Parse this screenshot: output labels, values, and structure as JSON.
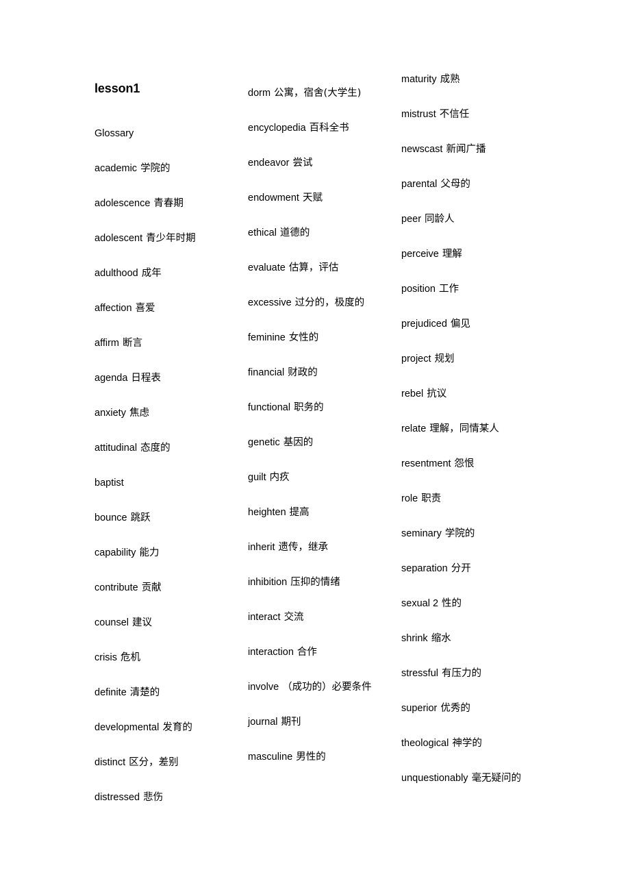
{
  "document": {
    "title": "lesson1",
    "columns": [
      {
        "id": "column-1",
        "entries": [
          {
            "term": "Glossary",
            "gloss": ""
          },
          {
            "term": "academic",
            "gloss": "学院的"
          },
          {
            "term": "adolescence",
            "gloss": "青春期"
          },
          {
            "term": "adolescent",
            "gloss": "青少年时期"
          },
          {
            "term": "adulthood",
            "gloss": "成年"
          },
          {
            "term": "affection",
            "gloss": "喜爱"
          },
          {
            "term": "affirm",
            "gloss": "断言"
          },
          {
            "term": "agenda",
            "gloss": "日程表"
          },
          {
            "term": "anxiety",
            "gloss": "焦虑"
          },
          {
            "term": "attitudinal",
            "gloss": "态度的"
          },
          {
            "term": "baptist",
            "gloss": ""
          },
          {
            "term": "bounce",
            "gloss": "跳跃"
          },
          {
            "term": "capability",
            "gloss": "能力"
          },
          {
            "term": "contribute",
            "gloss": "贡献"
          },
          {
            "term": "counsel",
            "gloss": "建议"
          },
          {
            "term": "crisis",
            "gloss": "危机"
          },
          {
            "term": "definite",
            "gloss": "清楚的"
          },
          {
            "term": "developmental",
            "gloss": "发育的"
          },
          {
            "term": "distinct",
            "gloss": "区分，差别"
          },
          {
            "term": "distressed",
            "gloss": "悲伤"
          }
        ]
      },
      {
        "id": "column-2",
        "entries": [
          {
            "term": "dorm",
            "gloss": "公寓，宿舍(大学生)"
          },
          {
            "term": "encyclopedia",
            "gloss": "百科全书"
          },
          {
            "term": "endeavor",
            "gloss": "尝试"
          },
          {
            "term": "endowment",
            "gloss": "天赋"
          },
          {
            "term": "ethical",
            "gloss": "道德的"
          },
          {
            "term": "evaluate",
            "gloss": "估算，评估"
          },
          {
            "term": "excessive",
            "gloss": "过分的，极度的"
          },
          {
            "term": "feminine",
            "gloss": "女性的"
          },
          {
            "term": "financial",
            "gloss": "财政的"
          },
          {
            "term": "functional",
            "gloss": "职务的"
          },
          {
            "term": "genetic",
            "gloss": "基因的"
          },
          {
            "term": "guilt",
            "gloss": "内疚"
          },
          {
            "term": "heighten",
            "gloss": "提高"
          },
          {
            "term": "inherit",
            "gloss": "遗传，继承"
          },
          {
            "term": "inhibition",
            "gloss": "压抑的情绪"
          },
          {
            "term": "interact",
            "gloss": "交流"
          },
          {
            "term": "interaction",
            "gloss": "合作"
          },
          {
            "term": "involve",
            "gloss": "（成功的）必要条件"
          },
          {
            "term": "journal",
            "gloss": "期刊"
          },
          {
            "term": "masculine",
            "gloss": "男性的"
          }
        ]
      },
      {
        "id": "column-3",
        "entries": [
          {
            "term": "maturity",
            "gloss": "成熟"
          },
          {
            "term": "mistrust",
            "gloss": "不信任"
          },
          {
            "term": "newscast",
            "gloss": "新闻广播"
          },
          {
            "term": "parental",
            "gloss": "父母的"
          },
          {
            "term": "peer",
            "gloss": "同龄人"
          },
          {
            "term": "perceive",
            "gloss": "理解"
          },
          {
            "term": "position",
            "gloss": "工作"
          },
          {
            "term": "prejudiced",
            "gloss": "偏见"
          },
          {
            "term": "project",
            "gloss": "规划"
          },
          {
            "term": "rebel",
            "gloss": "抗议"
          },
          {
            "term": "relate",
            "gloss": "理解，同情某人"
          },
          {
            "term": "resentment",
            "gloss": "怨恨"
          },
          {
            "term": "role",
            "gloss": "职责"
          },
          {
            "term": "seminary",
            "gloss": "学院的"
          },
          {
            "term": "separation",
            "gloss": "分开"
          },
          {
            "term": "sexual 2",
            "gloss": "性的"
          },
          {
            "term": "shrink",
            "gloss": "缩水"
          },
          {
            "term": "stressful",
            "gloss": "有压力的"
          },
          {
            "term": "superior",
            "gloss": "优秀的"
          },
          {
            "term": "theological",
            "gloss": "神学的"
          },
          {
            "term": "unquestionably",
            "gloss": "毫无疑问的"
          }
        ]
      }
    ]
  }
}
